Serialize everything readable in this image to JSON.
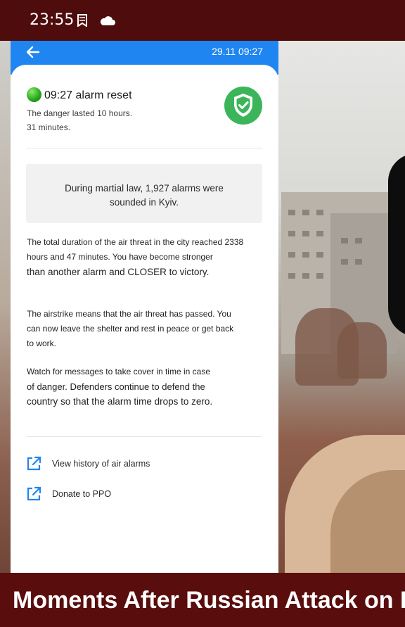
{
  "status_bar": {
    "time": "23:55"
  },
  "app": {
    "header_time": "29.11 09:27",
    "alert": {
      "title": "09:27 alarm reset",
      "duration_line1": "The danger lasted 10 hours.",
      "duration_line2": "31 minutes."
    },
    "summary_line1": "During martial law, 1,927 alarms were",
    "summary_line2": "sounded in Kyiv.",
    "paragraph1": {
      "line1": "The total duration of the air threat in the city reached 2338",
      "line2": "hours and 47 minutes. You have become stronger",
      "line3": "than another alarm and CLOSER to victory."
    },
    "paragraph2": {
      "line1": "The airstrike means that the air threat has passed. You",
      "line2": "can now leave the shelter and rest in peace or get back",
      "line3": "to work."
    },
    "paragraph3": {
      "line1": "Watch for messages to take cover in time in case",
      "line2": "of danger. Defenders continue to defend the",
      "line3": "country so that the alarm time drops to zero."
    },
    "links": [
      {
        "label": "View history of air alarms",
        "icon": "external-link-icon"
      },
      {
        "label": "Donate to PPO",
        "icon": "external-link-icon"
      }
    ]
  },
  "caption": "Moments After Russian Attack on K",
  "colors": {
    "app_bar": "#1f85f0",
    "shield": "#3cb55a",
    "caption_bg": "#5a0d0d",
    "link_icon": "#1f85f0"
  }
}
